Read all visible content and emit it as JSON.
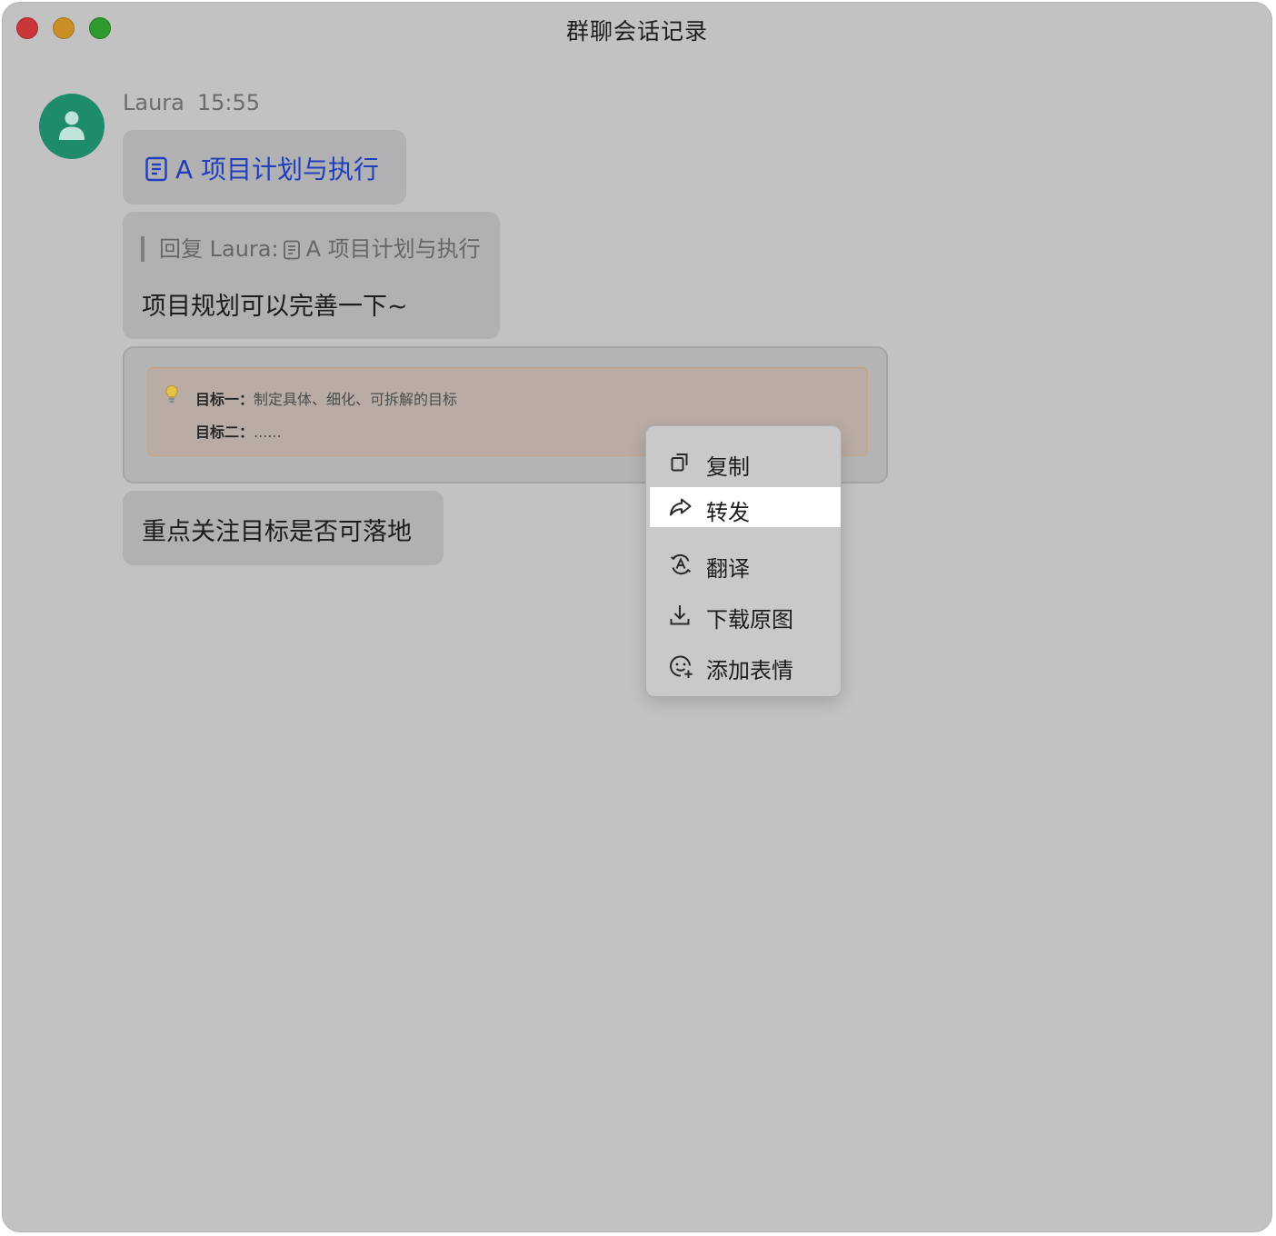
{
  "window": {
    "title": "群聊会话记录"
  },
  "message": {
    "sender": "Laura",
    "time": "15:55",
    "doc_link": {
      "icon": "document-icon",
      "title": "A 项目计划与执行"
    },
    "reply": {
      "quote_prefix": "回复 Laura:",
      "quote_doc_icon": "document-icon",
      "quote_doc_title": "A 项目计划与执行",
      "text": "项目规划可以完善一下~"
    },
    "callout": {
      "icon": "lightbulb-icon",
      "goal1_label": "目标一：",
      "goal1_text": "制定具体、细化、可拆解的目标",
      "goal2_label": "目标二：",
      "goal2_text": "......"
    },
    "focus_text": "重点关注目标是否可落地"
  },
  "context_menu": {
    "items": [
      {
        "label": "复制",
        "icon": "copy-icon"
      },
      {
        "label": "转发",
        "icon": "forward-icon",
        "selected": true
      },
      {
        "label": "翻译",
        "icon": "translate-icon"
      },
      {
        "label": "下载原图",
        "icon": "download-icon"
      },
      {
        "label": "添加表情",
        "icon": "add-emoji-icon"
      }
    ]
  }
}
